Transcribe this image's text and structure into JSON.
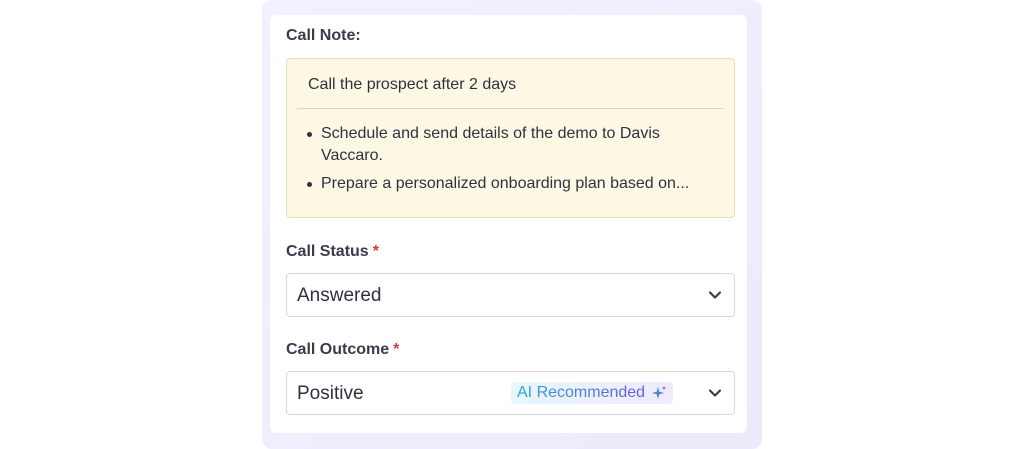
{
  "call_note": {
    "label": "Call Note:",
    "title": "Call the prospect after 2 days",
    "items": [
      "Schedule and send details of the demo to Davis Vaccaro.",
      "Prepare a personalized onboarding plan based on..."
    ]
  },
  "call_status": {
    "label": "Call Status",
    "required_mark": "*",
    "value": "Answered",
    "icon": "chevron-down-icon"
  },
  "call_outcome": {
    "label": "Call Outcome",
    "required_mark": "*",
    "value": "Positive",
    "badge": "AI Recommended",
    "badge_icon": "sparkle-icon",
    "icon": "chevron-down-icon"
  },
  "colors": {
    "required": "#d63a3a",
    "note_bg": "#fdf8e3",
    "ai_gradient_start": "#2ba7d3",
    "ai_gradient_end": "#6a5be0"
  }
}
